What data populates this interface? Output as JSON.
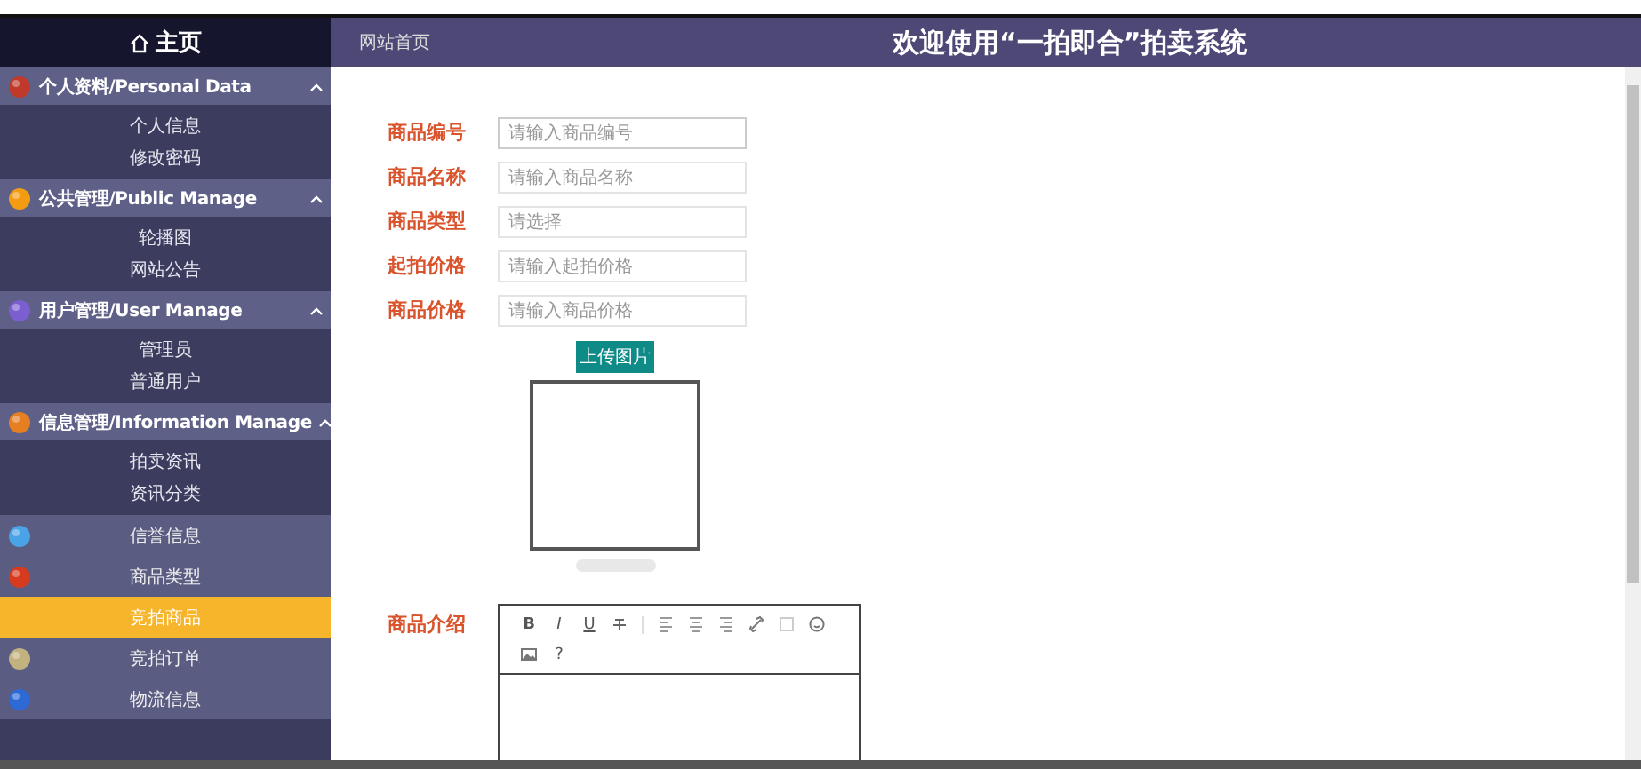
{
  "home": {
    "label": "主页"
  },
  "sidebar": {
    "groups": [
      {
        "label": "个人资料/Personal Data",
        "expanded": true,
        "items": [
          {
            "label": "个人信息",
            "selected": false
          },
          {
            "label": "修改密码",
            "selected": false
          }
        ]
      },
      {
        "label": "公共管理/Public Manage",
        "expanded": true,
        "items": [
          {
            "label": "轮播图",
            "selected": false
          },
          {
            "label": "网站公告",
            "selected": false
          }
        ]
      },
      {
        "label": "用户管理/User Manage",
        "expanded": true,
        "items": [
          {
            "label": "管理员",
            "selected": false
          },
          {
            "label": "普通用户",
            "selected": false
          }
        ]
      },
      {
        "label": "信息管理/Information Manage",
        "expanded": true,
        "items": [
          {
            "label": "拍卖资讯",
            "selected": false
          },
          {
            "label": "资讯分类",
            "selected": false
          }
        ]
      }
    ],
    "items": [
      {
        "label": "信誉信息",
        "selected": false
      },
      {
        "label": "商品类型",
        "selected": false
      },
      {
        "label": "竞拍商品",
        "selected": true
      },
      {
        "label": "竞拍订单",
        "selected": false
      },
      {
        "label": "物流信息",
        "selected": false
      }
    ]
  },
  "header": {
    "breadcrumb": "网站首页",
    "title": "欢迎使用“一拍即合”拍卖系统"
  },
  "form": {
    "fields": [
      {
        "label": "商品编号",
        "kind": "input",
        "placeholder": "请输入商品编号"
      },
      {
        "label": "商品名称",
        "kind": "input",
        "placeholder": "请输入商品名称"
      },
      {
        "label": "商品类型",
        "kind": "select",
        "placeholder": "请选择"
      },
      {
        "label": "起拍价格",
        "kind": "input",
        "placeholder": "请输入起拍价格"
      },
      {
        "label": "商品价格",
        "kind": "input",
        "placeholder": "请输入商品价格"
      }
    ],
    "upload_button": "上传图片",
    "upload_progress": {
      "level": 0
    },
    "description": {
      "label": "商品介绍",
      "format_buttons": [
        "B",
        "I",
        "U"
      ],
      "help_button": "?"
    }
  }
}
